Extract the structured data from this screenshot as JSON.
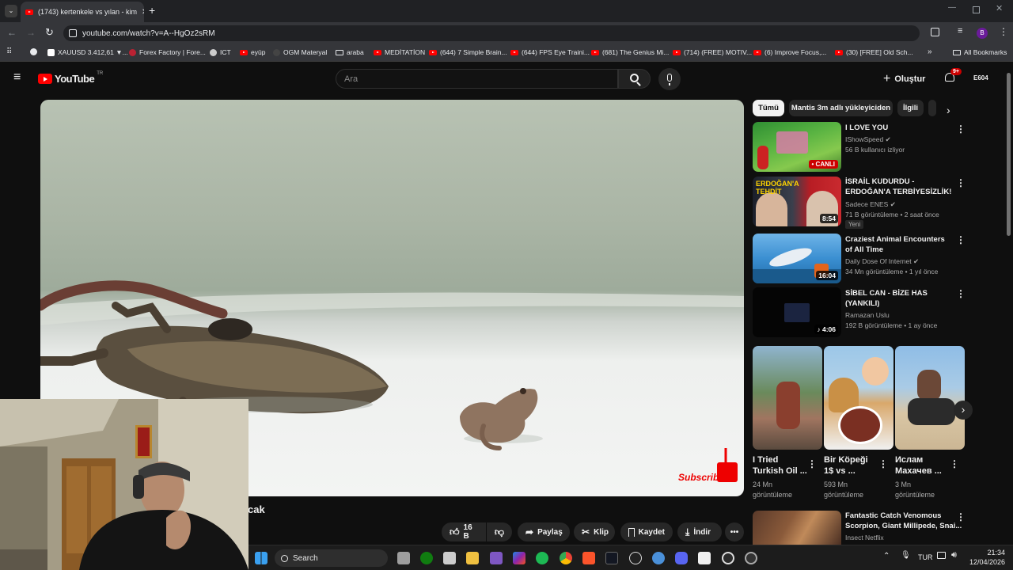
{
  "browser": {
    "tab_title": "(1743) kertenkele vs yılan - kim",
    "url": "youtube.com/watch?v=A--HgOz2sRM",
    "bookmarks": [
      "XAUUSD 3.412,61 ▼...",
      "Forex Factory | Fore...",
      "ICT",
      "eyüp",
      "OGM Materyal",
      "araba",
      "MEDİTATİON",
      "(644) 7 Simple Brain...",
      "(644) FPS Eye Traini...",
      "(681) The Genius Mi...",
      "(714) (FREE) MOTIV...",
      "(6) Improve Focus,...",
      "(30) [FREE] Old Sch..."
    ],
    "all_bookmarks": "All Bookmarks",
    "profile_initial": "B"
  },
  "youtube": {
    "logo": "YouTube",
    "country": "TR",
    "search_placeholder": "Ara",
    "create_label": "Oluştur",
    "notif_count": "9+",
    "account_label": "E604"
  },
  "video": {
    "title_fragment": "cak",
    "watermark": "Subscribe",
    "actions": {
      "likes": "16 B",
      "share": "Paylaş",
      "clip": "Klip",
      "save": "Kaydet",
      "download": "İndir"
    }
  },
  "chips": [
    "Tümü",
    "Mantis 3m adlı yükleyiciden",
    "İlgili"
  ],
  "recommendations": [
    {
      "title": "I LOVE YOU",
      "channel": "IShowSpeed",
      "meta": "56 B kullanıcı izliyor",
      "badge": "CANLI",
      "verified": true
    },
    {
      "title": "İSRAİL KUDURDU - ERDOĞAN'A TERBİYESİZLİK!",
      "channel": "Sadece ENES",
      "meta": "71 B görüntüleme • 2 saat önce",
      "duration": "8:54",
      "tag": "Yeni",
      "thumb_text": "ERDOĞAN'A TEHDİT",
      "verified": true
    },
    {
      "title": "Craziest Animal Encounters of All Time",
      "channel": "Daily Dose Of Internet",
      "meta": "34 Mn görüntüleme • 1 yıl önce",
      "duration": "16:04",
      "verified": true
    },
    {
      "title": "SİBEL CAN - BİZE HAS (YANKILI)",
      "channel": "Ramazan Uslu",
      "meta": "192 B görüntüleme • 1 ay önce",
      "duration": "4:06",
      "verified": false
    }
  ],
  "shorts": [
    {
      "title": "I Tried Turkish Oil ...",
      "views": "24 Mn görüntüleme"
    },
    {
      "title": "Bir Köpeği 1$ vs ...",
      "views": "593 Mn görüntüleme"
    },
    {
      "title": "Ислам Махачев ...",
      "views": "3 Mn görüntüleme"
    }
  ],
  "next_rec": {
    "title": "Fantastic Catch Venomous Scorpion, Giant Millipede, Snai...",
    "channel": "Insect Netflix"
  },
  "taskbar": {
    "search_label": "Search",
    "lang": "TUR",
    "time": "21:34",
    "date": "12/04/2026"
  },
  "colors": {
    "youtube_red": "#ff0000",
    "background": "#0f0f0f",
    "chip_bg": "#272727"
  }
}
